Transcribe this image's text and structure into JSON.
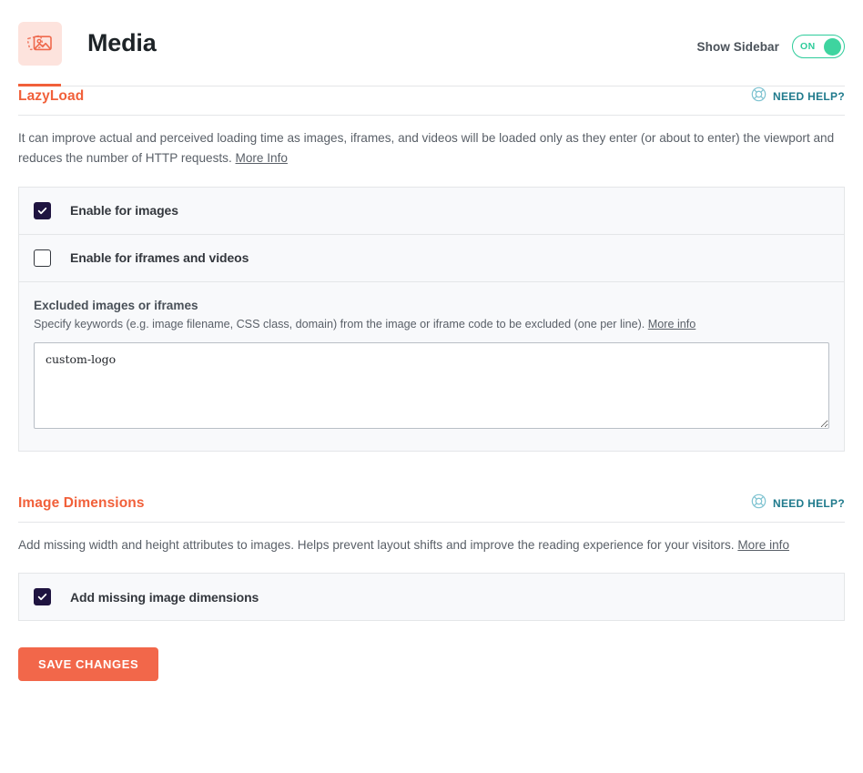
{
  "header": {
    "icon": "media-photos-icon",
    "title": "Media",
    "sidebar_toggle_label": "Show Sidebar",
    "sidebar_toggle_state": "ON",
    "accent_color": "#f1603a",
    "toggle_color": "#2ecc9b"
  },
  "sections": [
    {
      "id": "lazyload",
      "title": "LazyLoad",
      "help_label": "NEED HELP?",
      "help_icon": "lifebuoy-icon",
      "description_text": "It can improve actual and perceived loading time as images, iframes, and videos will be loaded only as they enter (or about to enter) the viewport and reduces the number of HTTP requests. ",
      "description_link": "More Info",
      "options": [
        {
          "label": "Enable for images",
          "checked": true
        },
        {
          "label": "Enable for iframes and videos",
          "checked": false
        }
      ],
      "field": {
        "label": "Excluded images or iframes",
        "help_text": "Specify keywords (e.g. image filename, CSS class, domain) from the image or iframe code to be excluded (one per line). ",
        "help_link": "More info",
        "value": "custom-logo",
        "placeholder": ""
      }
    },
    {
      "id": "image-dimensions",
      "title": "Image Dimensions",
      "help_label": "NEED HELP?",
      "help_icon": "lifebuoy-icon",
      "description_text": "Add missing width and height attributes to images. Helps prevent layout shifts and improve the reading experience for your visitors. ",
      "description_link": "More info",
      "options": [
        {
          "label": "Add missing image dimensions",
          "checked": true
        }
      ]
    }
  ],
  "footer": {
    "save_label": "SAVE CHANGES",
    "save_color": "#f2674a"
  }
}
